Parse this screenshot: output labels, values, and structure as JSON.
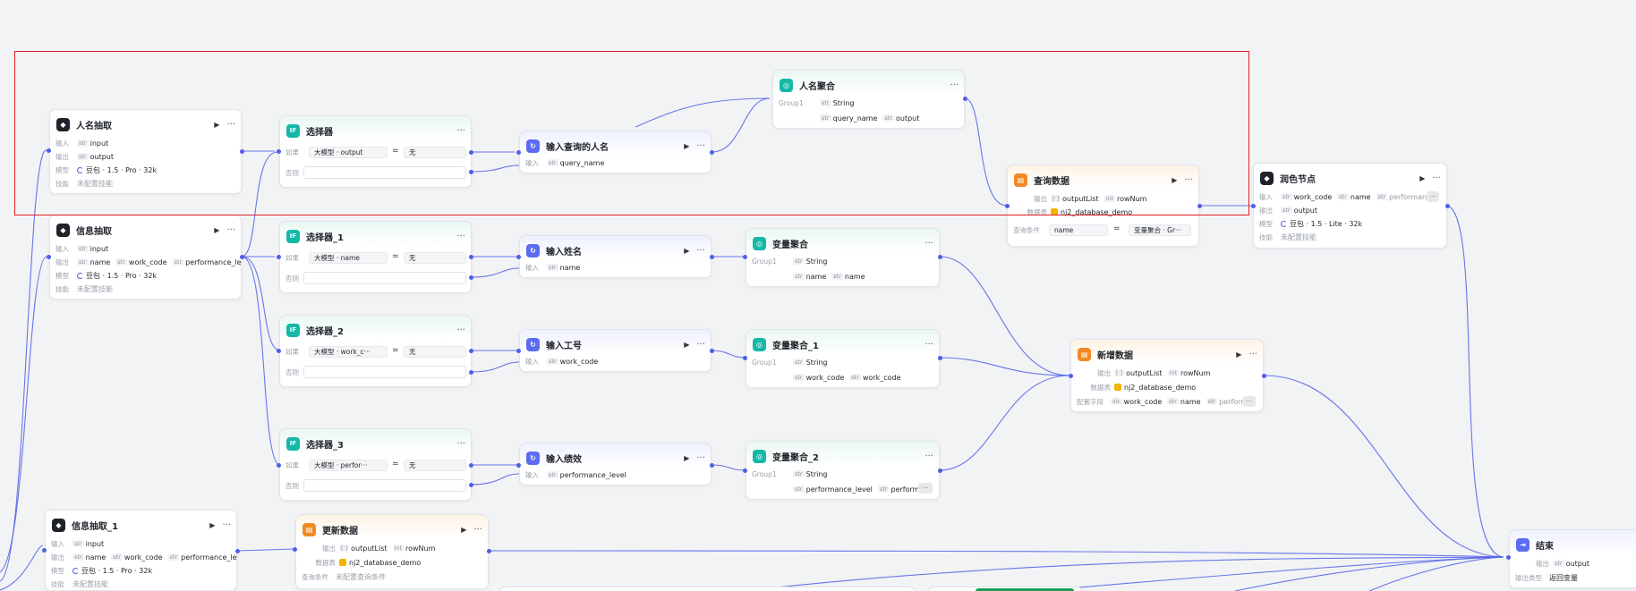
{
  "nodes": {
    "rm_extract": {
      "title": "人名抽取",
      "in_label": "输入",
      "in_tag": "str",
      "in_var": "input",
      "out_label": "输出",
      "out_tag": "str",
      "out_var": "output",
      "model_label": "模型",
      "model": "豆包 · 1.5 · Pro · 32k",
      "skill_label": "技能",
      "skill": "未配置技能"
    },
    "info_extract": {
      "title": "信息抽取",
      "in_label": "输入",
      "in_tag": "str",
      "in_var": "input",
      "out_label": "输出",
      "out1": "name",
      "out2": "work_code",
      "out3": "performance_level",
      "model_label": "模型",
      "model": "豆包 · 1.5 · Pro · 32k",
      "skill_label": "技能",
      "skill": "未配置技能"
    },
    "info_extract_1": {
      "title": "信息抽取_1",
      "in_label": "输入",
      "in_var": "input",
      "out_label": "输出",
      "out1": "name",
      "out2": "work_code",
      "out3": "performance_level",
      "model_label": "模型",
      "model": "豆包 · 1.5 · Pro · 32k",
      "skill_label": "技能",
      "skill": "未配置技能"
    },
    "sel": {
      "title": "选择器",
      "if_label": "如果",
      "else_label": "否则",
      "src": "大模型",
      "field": "output",
      "eq": "=",
      "value": "无"
    },
    "sel_1": {
      "title": "选择器_1",
      "if_label": "如果",
      "else_label": "否则",
      "src": "大模型",
      "field": "name",
      "eq": "=",
      "value": "无"
    },
    "sel_2": {
      "title": "选择器_2",
      "if_label": "如果",
      "else_label": "否则",
      "src": "大模型",
      "field": "work_c···",
      "eq": "=",
      "value": "无"
    },
    "sel_3": {
      "title": "选择器_3",
      "if_label": "如果",
      "else_label": "否则",
      "src": "大模型",
      "field": "perfor···",
      "eq": "=",
      "value": "无"
    },
    "in_query_name": {
      "title": "输入查询的人名",
      "in_label": "输入",
      "var": "query_name"
    },
    "in_name": {
      "title": "输入姓名",
      "in_label": "输入",
      "var": "name"
    },
    "in_work": {
      "title": "输入工号",
      "in_label": "输入",
      "var": "work_code"
    },
    "in_perf": {
      "title": "输入绩效",
      "in_label": "输入",
      "var": "performance_level"
    },
    "agg_name": {
      "title": "人名聚合",
      "group": "Group1",
      "type": "String",
      "v1": "query_name",
      "v2": "output"
    },
    "agg_var": {
      "title": "变量聚合",
      "group": "Group1",
      "type": "String",
      "v1": "name",
      "v2": "name"
    },
    "agg_var_1": {
      "title": "变量聚合_1",
      "group": "Group1",
      "type": "String",
      "v1": "work_code",
      "v2": "work_code"
    },
    "agg_var_2": {
      "title": "变量聚合_2",
      "group": "Group1",
      "type": "String",
      "v1": "performance_level",
      "v2": "perform",
      "more": "···"
    },
    "query_db": {
      "title": "查询数据",
      "out_label": "输出",
      "out1": "outputList",
      "out2": "rowNum",
      "db_label": "数据表",
      "db": "nj2_database_demo",
      "cond_label": "查询条件",
      "cond_field": "name",
      "cond_eq": "=",
      "cond_val": "变量聚合 · Gr···"
    },
    "polish": {
      "title": "润色节点",
      "in_label": "输入",
      "in1": "work_code",
      "in2": "name",
      "in3": "performance",
      "out_label": "输出",
      "out_var": "output",
      "model_label": "模型",
      "model": "豆包 · 1.5 · Lite · 32k",
      "skill_label": "技能",
      "skill": "未配置技能",
      "more": "···"
    },
    "add_db": {
      "title": "新增数据",
      "out_label": "输出",
      "out1": "outputList",
      "out2": "rowNum",
      "db_label": "数据表",
      "db": "nj2_database_demo",
      "cfg_label": "配置字段",
      "f1": "work_code",
      "f2": "name",
      "f3": "perform",
      "more": "···"
    },
    "update_db": {
      "title": "更新数据",
      "out_label": "输出",
      "out1": "outputList",
      "out2": "rowNum",
      "db_label": "数据表",
      "db": "nj2_database_demo",
      "cond_label": "查询条件",
      "cond": "未配置查询条件"
    },
    "end": {
      "title": "结束",
      "out_label": "输出",
      "out_var": "output",
      "mode_label": "输出类型",
      "mode": "返回变量"
    }
  },
  "tags": {
    "str": "str",
    "arr": "[·]",
    "int": "int"
  },
  "colors": {
    "edge": "#4f5fe6",
    "selection": "#e02020"
  }
}
